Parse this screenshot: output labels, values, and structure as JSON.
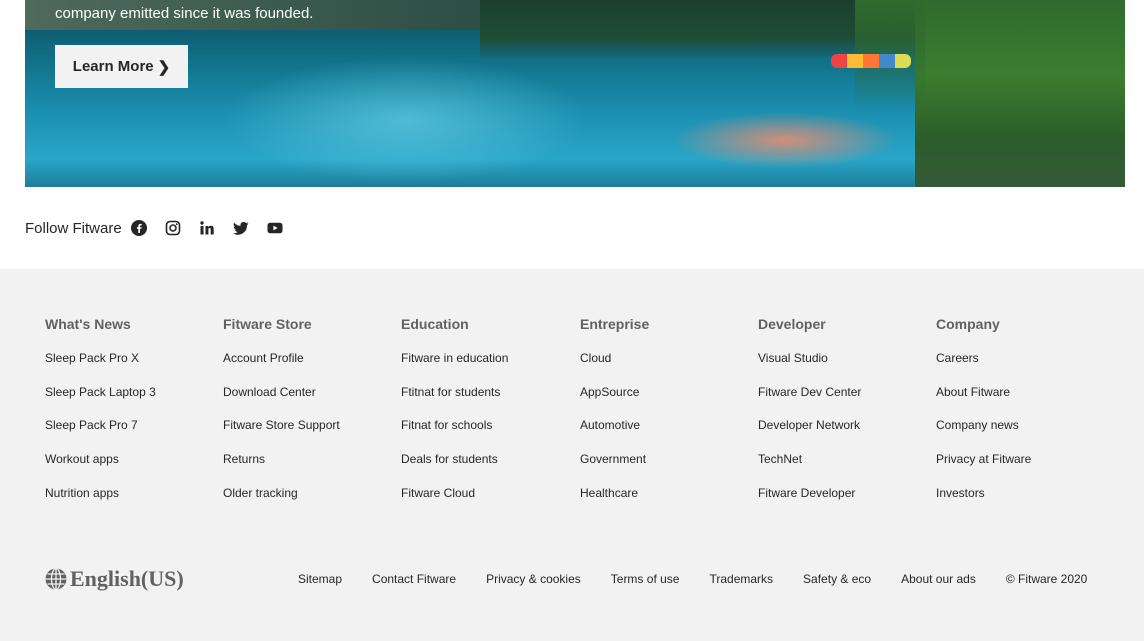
{
  "hero": {
    "description": "company emitted since it was founded.",
    "learn_more_label": "Learn More",
    "chevron_glyph": "❯"
  },
  "follow": {
    "label": "Follow Fitware",
    "icons": [
      "facebook-icon",
      "instagram-icon",
      "linkedin-icon",
      "twitter-icon",
      "youtube-icon"
    ]
  },
  "footer": {
    "columns": [
      {
        "title": "What's News",
        "links": [
          "Sleep Pack Pro X",
          "Sleep Pack Laptop 3",
          "Sleep Pack Pro 7",
          "Workout apps",
          "Nutrition apps"
        ]
      },
      {
        "title": "Fitware Store",
        "links": [
          "Account Profile",
          "Download Center",
          "Fitware Store Support",
          "Returns",
          "Older tracking"
        ]
      },
      {
        "title": "Education",
        "links": [
          "Fitware in education",
          "Ftitnat for students",
          "Fitnat for schools",
          "Deals for students",
          "Fitware Cloud"
        ]
      },
      {
        "title": "Entreprise",
        "links": [
          "Cloud",
          "AppSource",
          "Automotive",
          "Government",
          "Healthcare"
        ]
      },
      {
        "title": "Developer",
        "links": [
          "Visual Studio",
          "Fitware Dev Center",
          "Developer Network",
          "TechNet",
          "Fitware Developer"
        ]
      },
      {
        "title": "Company",
        "links": [
          "Careers",
          "About Fitware",
          "Company news",
          "Privacy at Fitware",
          "Investors"
        ]
      }
    ],
    "locale": "English(US)",
    "bottom_links": [
      "Sitemap",
      "Contact Fitware",
      "Privacy & cookies",
      "Terms of use",
      "Trademarks",
      "Safety & eco",
      "About our ads"
    ],
    "copyright": "© Fitware 2020"
  },
  "colors": {
    "footer_bg": "#f2f2f2",
    "heading": "#616161",
    "text": "#262626"
  }
}
